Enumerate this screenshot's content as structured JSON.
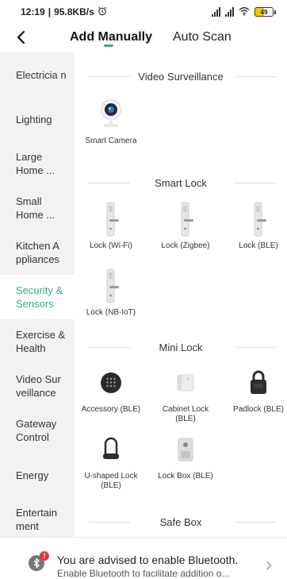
{
  "status_bar": {
    "time": "12:19",
    "speed": "95.8KB/s",
    "battery": "49"
  },
  "header": {
    "tabs": [
      {
        "label": "Add Manually",
        "active": true
      },
      {
        "label": "Auto Scan",
        "active": false
      }
    ]
  },
  "sidebar": {
    "items": [
      {
        "label": "Electricia n",
        "id": "electrician"
      },
      {
        "label": "Lighting",
        "id": "lighting"
      },
      {
        "label": "Large Home ...",
        "id": "large-home"
      },
      {
        "label": "Small Home ...",
        "id": "small-home"
      },
      {
        "label": "Kitchen A ppliances",
        "id": "kitchen"
      },
      {
        "label": "Security & Sensors",
        "id": "security",
        "active": true
      },
      {
        "label": "Exercise & Health",
        "id": "exercise"
      },
      {
        "label": "Video Sur veillance",
        "id": "video"
      },
      {
        "label": "Gateway Control",
        "id": "gateway"
      },
      {
        "label": "Energy",
        "id": "energy"
      },
      {
        "label": "Entertain ment",
        "id": "entertainment"
      }
    ]
  },
  "sections": [
    {
      "title": "Video Surveillance",
      "devices": [
        {
          "name": "Smart Camera",
          "icon": "camera-icon"
        }
      ]
    },
    {
      "title": "Smart Lock",
      "devices": [
        {
          "name": "Lock (Wi-Fi)",
          "icon": "door-lock-icon"
        },
        {
          "name": "Lock (Zigbee)",
          "icon": "door-lock-icon"
        },
        {
          "name": "Lock (BLE)",
          "icon": "door-lock-icon"
        },
        {
          "name": "Lock (NB-IoT)",
          "icon": "door-lock-icon"
        }
      ]
    },
    {
      "title": "Mini Lock",
      "devices": [
        {
          "name": "Accessory (BLE)",
          "icon": "keypad-icon"
        },
        {
          "name": "Cabinet Lock (BLE)",
          "icon": "cabinet-lock-icon"
        },
        {
          "name": "Padlock (BLE)",
          "icon": "padlock-icon"
        },
        {
          "name": "U-shaped Lock (BLE)",
          "icon": "u-lock-icon"
        },
        {
          "name": "Lock Box (BLE)",
          "icon": "lock-box-icon"
        }
      ]
    },
    {
      "title": "Safe Box",
      "devices": []
    }
  ],
  "bluetooth_banner": {
    "title": "You are advised to enable Bluetooth.",
    "subtitle": "Enable Bluetooth to facilitate addition o..."
  },
  "colors": {
    "accent": "#2ab27b",
    "sidebar_bg": "#f2f2f2",
    "alert": "#e53935"
  }
}
